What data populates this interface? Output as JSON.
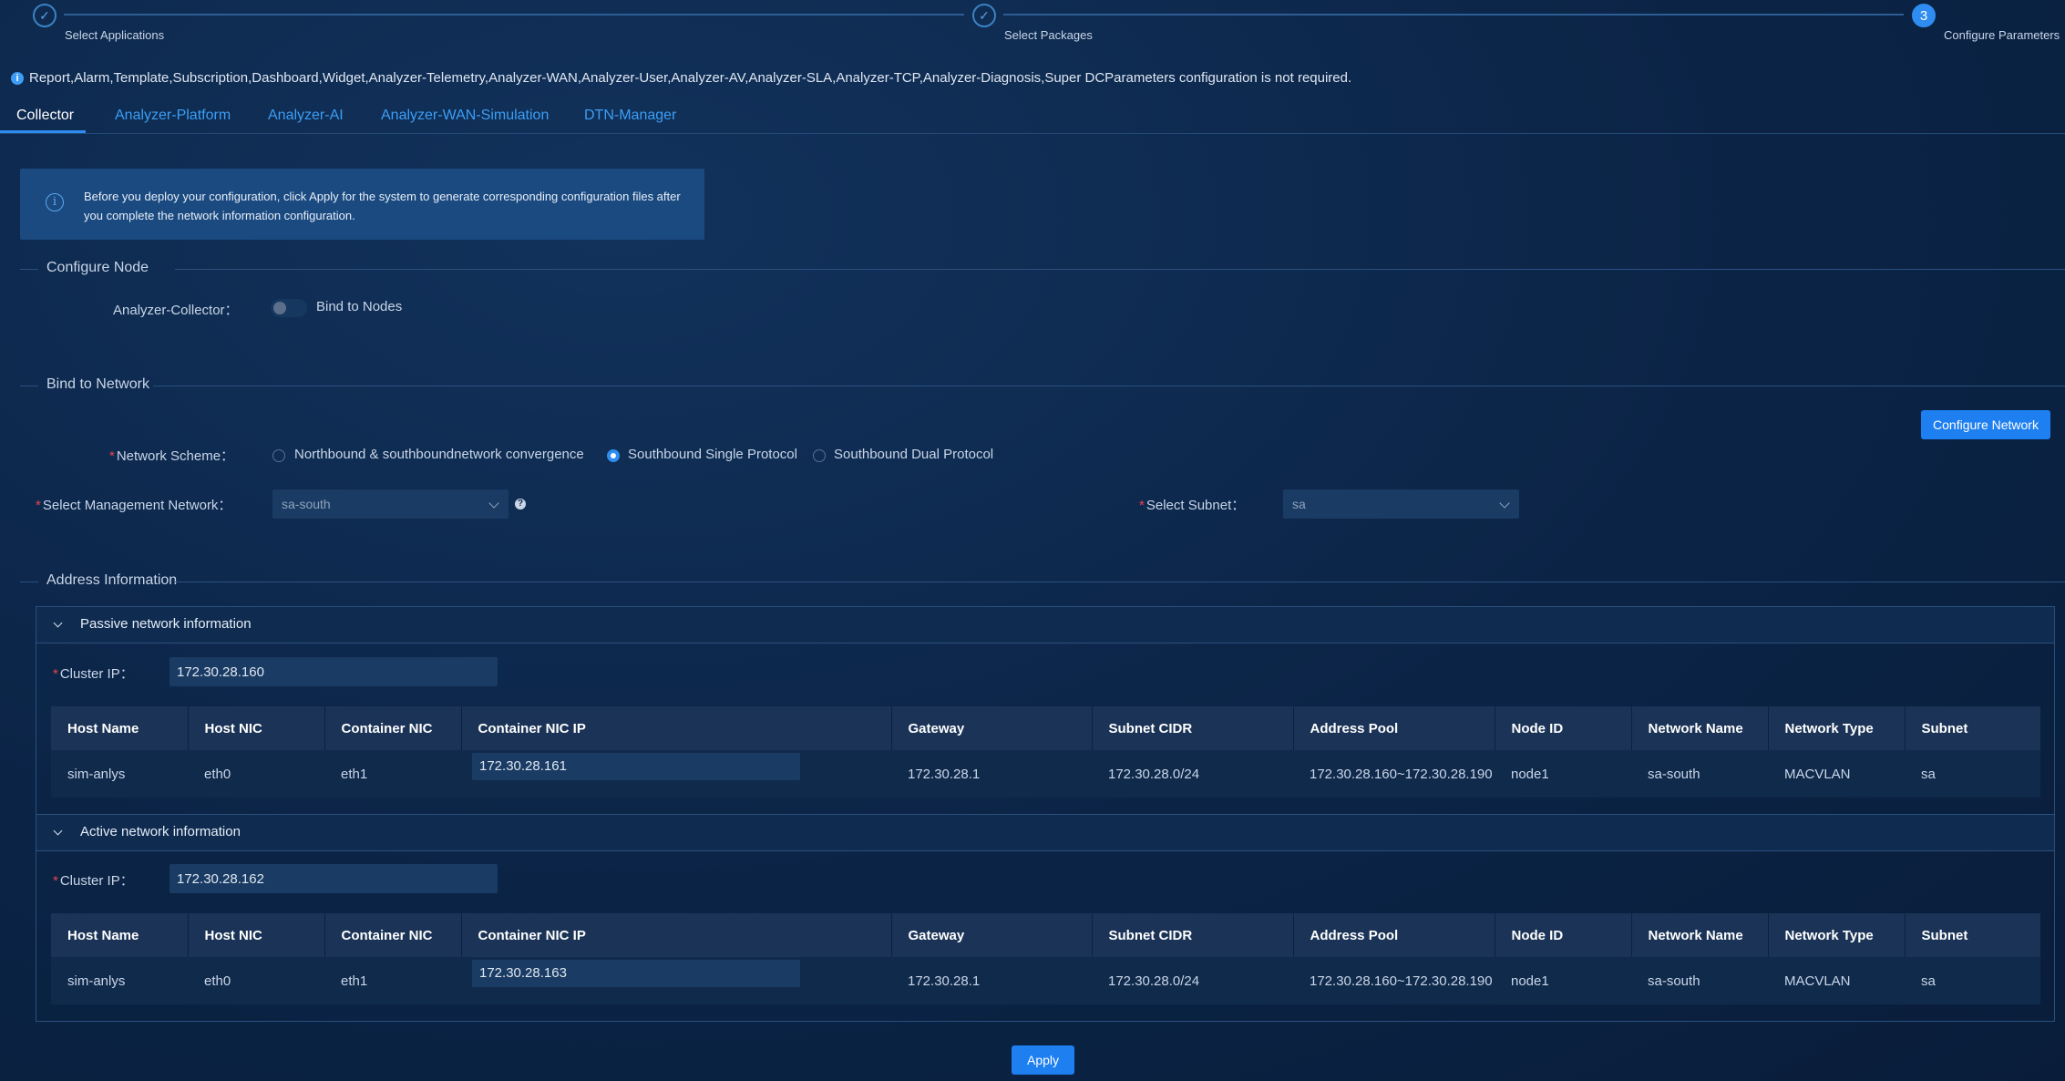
{
  "steps": [
    {
      "label": "Select Applications",
      "state": "done"
    },
    {
      "label": "Select Packages",
      "state": "done"
    },
    {
      "label": "Configure Parameters",
      "state": "active",
      "number": "3"
    }
  ],
  "info_message": "Report,Alarm,Template,Subscription,Dashboard,Widget,Analyzer-Telemetry,Analyzer-WAN,Analyzer-User,Analyzer-AV,Analyzer-SLA,Analyzer-TCP,Analyzer-Diagnosis,Super DCParameters configuration is not required.",
  "tabs": [
    "Collector",
    "Analyzer-Platform",
    "Analyzer-AI",
    "Analyzer-WAN-Simulation",
    "DTN-Manager"
  ],
  "active_tab": "Collector",
  "notice": "Before you deploy your configuration, click Apply for the system to generate corresponding configuration files after you complete the network information configuration.",
  "configure_node": {
    "title": "Configure Node",
    "field_label": "Analyzer-Collector：",
    "switch_label": "Bind to Nodes",
    "switch_on": false
  },
  "bind_network": {
    "title": "Bind to Network",
    "configure_button": "Configure Network",
    "scheme_label": "Network Scheme：",
    "scheme_options": [
      "Northbound & southboundnetwork convergence",
      "Southbound Single Protocol",
      "Southbound Dual Protocol"
    ],
    "scheme_selected": "Southbound Single Protocol",
    "mgmt_label": "Select Management Network：",
    "mgmt_value": "sa-south",
    "subnet_label": "Select Subnet：",
    "subnet_value": "sa"
  },
  "address_info": {
    "title": "Address Information",
    "columns": [
      "Host Name",
      "Host NIC",
      "Container NIC",
      "Container NIC IP",
      "Gateway",
      "Subnet CIDR",
      "Address Pool",
      "Node ID",
      "Network Name",
      "Network Type",
      "Subnet"
    ],
    "passive": {
      "title": "Passive network information",
      "cluster_label": "Cluster IP：",
      "cluster_ip": "172.30.28.160",
      "row": [
        "sim-anlys",
        "eth0",
        "eth1",
        "172.30.28.161",
        "172.30.28.1",
        "172.30.28.0/24",
        "172.30.28.160~172.30.28.190",
        "node1",
        "sa-south",
        "MACVLAN",
        "sa"
      ]
    },
    "active": {
      "title": "Active network information",
      "cluster_label": "Cluster IP：",
      "cluster_ip": "172.30.28.162",
      "row": [
        "sim-anlys",
        "eth0",
        "eth1",
        "172.30.28.163",
        "172.30.28.1",
        "172.30.28.0/24",
        "172.30.28.160~172.30.28.190",
        "node1",
        "sa-south",
        "MACVLAN",
        "sa"
      ]
    }
  },
  "apply_button": "Apply",
  "colors": {
    "accent": "#2f8cf0",
    "background": "#0b2446",
    "required": "#e8454d"
  }
}
